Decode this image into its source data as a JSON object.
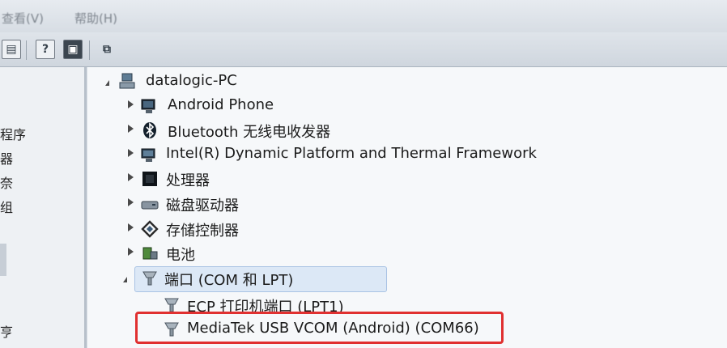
{
  "menubar": {
    "view_label": "查看(V)",
    "help_label": "帮助(H)"
  },
  "left_pane": {
    "items": [
      "程序",
      "器",
      "奈",
      "组",
      "亨"
    ]
  },
  "tree": {
    "root": "datalogic-PC",
    "categories": [
      {
        "label": "Android Phone"
      },
      {
        "label": "Bluetooth 无线电收发器"
      },
      {
        "label": "Intel(R) Dynamic Platform and Thermal Framework"
      },
      {
        "label": "处理器"
      },
      {
        "label": "磁盘驱动器"
      },
      {
        "label": "存储控制器"
      },
      {
        "label": "电池"
      },
      {
        "label": "端口 (COM 和 LPT)"
      }
    ],
    "ports": [
      {
        "label": "ECP 打印机端口 (LPT1)"
      },
      {
        "label": "MediaTek USB VCOM (Android) (COM66)"
      }
    ]
  },
  "colors": {
    "highlight": "#e03030",
    "selection": "#dce8f6"
  }
}
